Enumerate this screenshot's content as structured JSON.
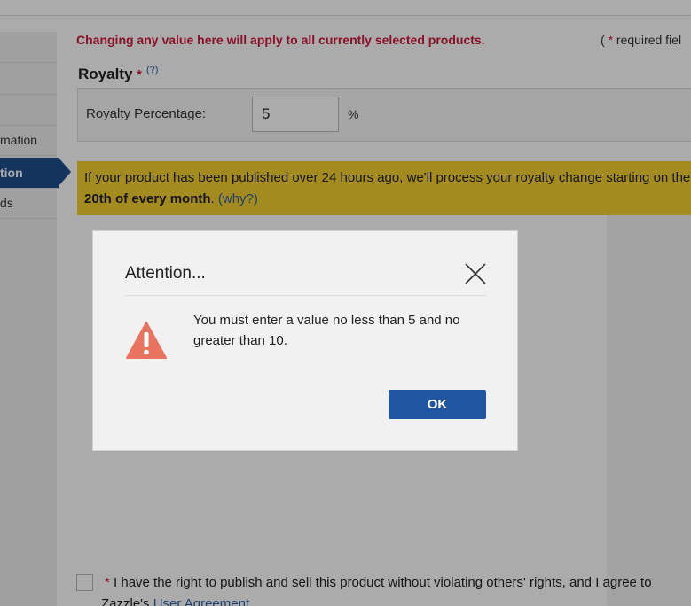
{
  "sidebar": {
    "items": [
      {
        "label": ""
      },
      {
        "label": ""
      },
      {
        "label": ""
      },
      {
        "label": "mation"
      },
      {
        "label": "tion"
      },
      {
        "label": "ds"
      }
    ]
  },
  "main": {
    "notice": "Changing any value here will apply to all currently selected products.",
    "required_prefix": "( ",
    "required_star": "*",
    "required_text": " required fiel",
    "royalty_title": "Royalty",
    "royalty_star": "*",
    "royalty_help": "(?)",
    "royalty_label": "Royalty Percentage:",
    "royalty_value": "5",
    "royalty_unit": "%",
    "banner_text_1": "If your product has been published over 24 hours ago, we'll process your royalty change starting on the ",
    "banner_bold": "20th of every month",
    "banner_text_2": ". ",
    "banner_why": "(why?)",
    "agree_star": "*",
    "agree_text": " I have the right to publish and sell this product without violating others' rights, and I agree to",
    "agree_text2_prefix": "Zazzle's ",
    "agree_link": "User Agreement"
  },
  "dialog": {
    "title": "Attention...",
    "message": "You must enter a value no less than 5 and no greater than 10.",
    "ok_label": "OK",
    "icon": "warning-triangle-icon",
    "close_icon": "close-icon",
    "warn_color": "#e8745f",
    "button_color": "#2055a0"
  }
}
